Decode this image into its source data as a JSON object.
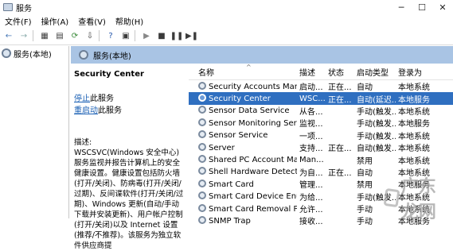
{
  "window": {
    "title": "服务"
  },
  "menu": [
    "文件(F)",
    "操作(A)",
    "查看(V)",
    "帮助(H)"
  ],
  "tree": {
    "item": "服务(本地)"
  },
  "pane": {
    "header": "服务(本地)"
  },
  "detail": {
    "title": "Security Center",
    "stop_link": "停止",
    "stop_suffix": "此服务",
    "restart_link": "重启动",
    "restart_suffix": "此服务",
    "desc_label": "描述:",
    "desc_text": "WSCSVC(Windows 安全中心)服务监视并报告计算机上的安全健康设置。健康设置包括防火墙(打开/关闭)、防病毒(打开/关闭/过期)、反间谍软件(打开/关闭/过期)、Windows 更新(自动/手动下载并安装更新)、用户帐户控制(打开/关闭)以及 Internet 设置(推荐/不推荐)。该服务为独立软件供应商提"
  },
  "columns": [
    "名称",
    "描述",
    "状态",
    "启动类型",
    "登录为"
  ],
  "rows": [
    {
      "name": "Security Accounts Manag...",
      "desc": "启动...",
      "status": "正在...",
      "startup": "自动",
      "logon": "本地系统"
    },
    {
      "name": "Security Center",
      "desc": "WSC...",
      "status": "正在...",
      "startup": "自动(延迟...",
      "logon": "本地服务",
      "selected": true
    },
    {
      "name": "Sensor Data Service",
      "desc": "从各...",
      "status": "",
      "startup": "手动(触发...",
      "logon": "本地系统"
    },
    {
      "name": "Sensor Monitoring Service",
      "desc": "监视...",
      "status": "",
      "startup": "手动(触发...",
      "logon": "本地服务"
    },
    {
      "name": "Sensor Service",
      "desc": "一项...",
      "status": "",
      "startup": "手动(触发...",
      "logon": "本地系统"
    },
    {
      "name": "Server",
      "desc": "支持...",
      "status": "正在...",
      "startup": "自动(触发...",
      "logon": "本地系统"
    },
    {
      "name": "Shared PC Account Mana...",
      "desc": "Man...",
      "status": "",
      "startup": "禁用",
      "logon": "本地系统"
    },
    {
      "name": "Shell Hardware Detection",
      "desc": "为自...",
      "status": "正在...",
      "startup": "自动",
      "logon": "本地系统"
    },
    {
      "name": "Smart Card",
      "desc": "管理...",
      "status": "",
      "startup": "禁用",
      "logon": "本地服务"
    },
    {
      "name": "Smart Card Device Enum...",
      "desc": "为给...",
      "status": "",
      "startup": "手动(触发...",
      "logon": "本地系统"
    },
    {
      "name": "Smart Card Removal Poli...",
      "desc": "允许...",
      "status": "",
      "startup": "手动",
      "logon": "本地系统"
    },
    {
      "name": "SNMP Trap",
      "desc": "接收...",
      "status": "",
      "startup": "手动",
      "logon": "本地服务"
    }
  ],
  "watermark": "广东龙网"
}
